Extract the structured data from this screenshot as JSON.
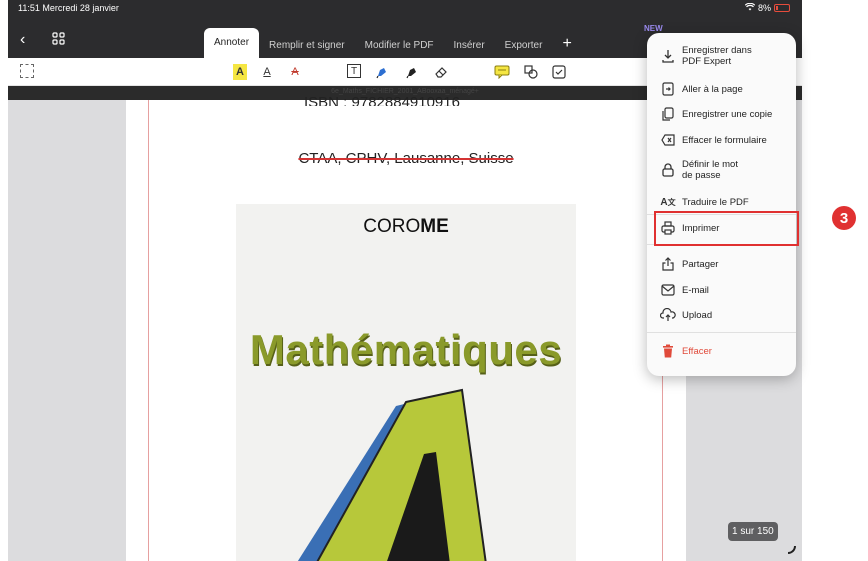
{
  "status": {
    "time": "11:51",
    "date": "Mercredi 28 janvier",
    "battery": "8%"
  },
  "new_badge": "NEW",
  "tabs": [
    {
      "label": "Annoter",
      "active": true
    },
    {
      "label": "Remplir et signer"
    },
    {
      "label": "Modifier le PDF"
    },
    {
      "label": "Insérer"
    },
    {
      "label": "Exporter"
    }
  ],
  "tab_add": "+",
  "nav": {
    "back": "‹"
  },
  "toolbar": {
    "text_tool": "T",
    "highlight": "A",
    "underline": "A",
    "strike": "A"
  },
  "document": {
    "filename": "6e_Maths_FICHIER_2001_ABooxaa_ménagé+",
    "isbn": "ISBN : 9782884910916",
    "publisher": "CTAA, CPHV, Lausanne, Suisse",
    "cover_brand_light": "CORO",
    "cover_brand_bold": "ME",
    "cover_title": "Mathématiques"
  },
  "page_indicator": "1 sur 150",
  "menu": {
    "items": [
      {
        "label_line1": "Enregistrer dans",
        "label_line2": "PDF Expert",
        "icon": "download-icon"
      },
      {
        "label_line1": "Aller à la page",
        "icon": "page-goto-icon"
      },
      {
        "label_line1": "Enregistrer une copie",
        "icon": "copy-icon"
      },
      {
        "label_line1": "Effacer le formulaire",
        "icon": "clear-form-icon"
      },
      {
        "label_line1": "Définir le mot",
        "label_line2": "de passe",
        "icon": "lock-icon"
      },
      {
        "label_line1": "Traduire le PDF",
        "icon": "translate-icon"
      },
      {
        "label_line1": "Imprimer",
        "icon": "printer-icon"
      },
      {
        "label_line1": "Partager",
        "icon": "share-icon"
      },
      {
        "label_line1": "E-mail",
        "icon": "mail-icon"
      },
      {
        "label_line1": "Upload",
        "icon": "cloud-upload-icon"
      },
      {
        "label_line1": "Effacer",
        "icon": "trash-icon",
        "color": "#e04a3a"
      }
    ]
  },
  "step_badge": "3",
  "colors": {
    "accent_red": "#e03131",
    "highlight_yellow": "#f5e642",
    "title_green": "#8a9a2a"
  }
}
